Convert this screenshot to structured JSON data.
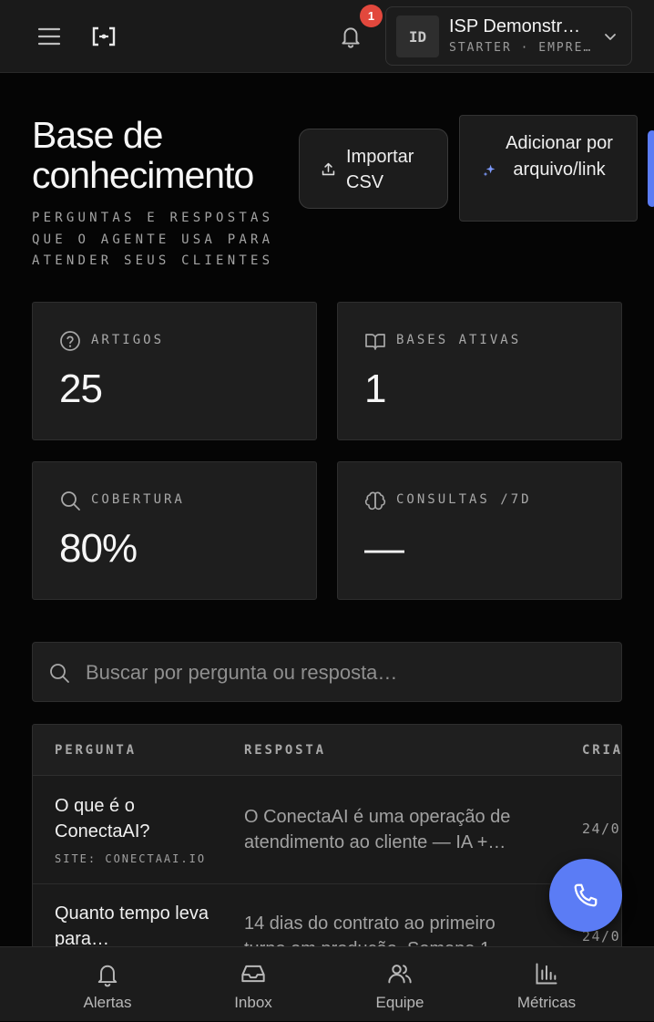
{
  "topbar": {
    "notification_count": "1",
    "account": {
      "initials": "ID",
      "name": "ISP Demonstr…",
      "plan": "STARTER · EMPRE…"
    }
  },
  "header": {
    "title": "Base de conhecimento",
    "subtitle": "PERGUNTAS E RESPOSTAS QUE O AGENTE USA PARA ATENDER SEUS CLIENTES",
    "import_label": "Importar CSV",
    "add_label": "Adicionar por arquivo/link"
  },
  "stats": [
    {
      "label": "ARTIGOS",
      "value": "25",
      "icon": "help-circle-icon"
    },
    {
      "label": "BASES ATIVAS",
      "value": "1",
      "icon": "book-open-icon"
    },
    {
      "label": "COBERTURA",
      "value": "80%",
      "icon": "search-icon"
    },
    {
      "label": "CONSULTAS /7D",
      "value": "—",
      "icon": "brain-icon"
    }
  ],
  "search": {
    "placeholder": "Buscar por pergunta ou resposta…"
  },
  "table": {
    "columns": [
      "PERGUNTA",
      "RESPOSTA",
      "CRIA"
    ],
    "rows": [
      {
        "question": "O que é o ConectaAI?",
        "source": "SITE: CONECTAAI.IO",
        "answer": "O ConectaAI é uma operação de atendimento ao cliente — IA +…",
        "date": "24/0"
      },
      {
        "question": "Quanto tempo leva para…",
        "source": "",
        "answer": "14 dias do contrato ao primeiro turno em produção. Semana 1…",
        "date": "24/0"
      }
    ]
  },
  "bottom_nav": [
    {
      "label": "Alertas",
      "icon": "bell-icon"
    },
    {
      "label": "Inbox",
      "icon": "inbox-icon"
    },
    {
      "label": "Equipe",
      "icon": "users-icon"
    },
    {
      "label": "Métricas",
      "icon": "bar-chart-icon"
    }
  ],
  "colors": {
    "accent": "#5b7cf5",
    "badge": "#e2483d",
    "background": "#050505",
    "surface": "#1e1e1e"
  }
}
